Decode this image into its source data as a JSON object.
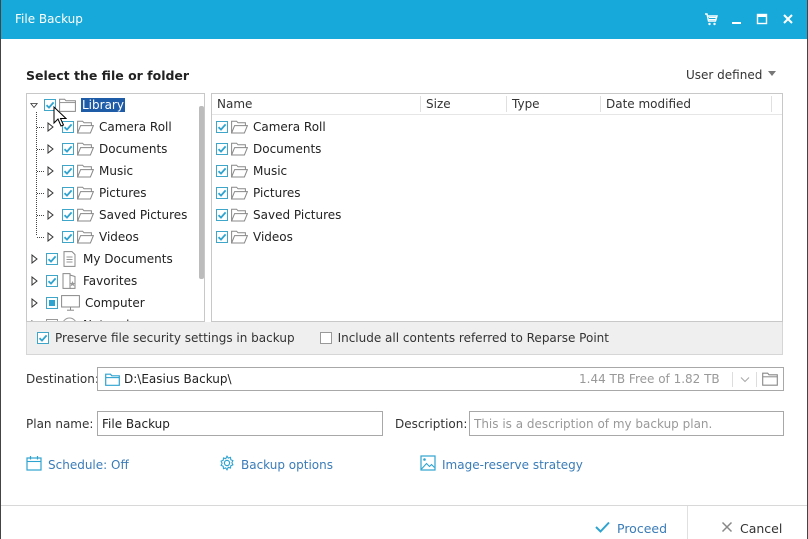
{
  "window": {
    "title": "File Backup",
    "controls": [
      {
        "name": "cart-icon",
        "glyph": "cart"
      },
      {
        "name": "minimize-icon",
        "glyph": "minimize"
      },
      {
        "name": "maximize-icon",
        "glyph": "maximize"
      },
      {
        "name": "close-icon",
        "glyph": "close"
      }
    ]
  },
  "colors": {
    "titlebar": "#17a9da",
    "accent": "#2fa3d0",
    "link": "#3a7cb8",
    "selection": "#1e5ca8"
  },
  "selector": {
    "title": "Select the file or folder",
    "mode": "User defined"
  },
  "tree": {
    "items": [
      {
        "label": "Library",
        "level": 0,
        "expanded": true,
        "checked": "checked",
        "icon": "folder-icon",
        "selected": true
      },
      {
        "label": "Camera Roll",
        "level": 1,
        "expanded": false,
        "checked": "checked",
        "icon": "folder-open-icon"
      },
      {
        "label": "Documents",
        "level": 1,
        "expanded": false,
        "checked": "checked",
        "icon": "folder-open-icon"
      },
      {
        "label": "Music",
        "level": 1,
        "expanded": false,
        "checked": "checked",
        "icon": "folder-open-icon"
      },
      {
        "label": "Pictures",
        "level": 1,
        "expanded": false,
        "checked": "checked",
        "icon": "folder-open-icon"
      },
      {
        "label": "Saved Pictures",
        "level": 1,
        "expanded": false,
        "checked": "checked",
        "icon": "folder-open-icon"
      },
      {
        "label": "Videos",
        "level": 1,
        "expanded": false,
        "checked": "checked",
        "icon": "folder-open-icon"
      },
      {
        "label": "My Documents",
        "level": 0,
        "expanded": false,
        "checked": "checked",
        "icon": "document-icon"
      },
      {
        "label": "Favorites",
        "level": 0,
        "expanded": false,
        "checked": "checked",
        "icon": "favorites-icon"
      },
      {
        "label": "Computer",
        "level": 0,
        "expanded": false,
        "checked": "partial",
        "icon": "computer-icon"
      },
      {
        "label": "Network",
        "level": 0,
        "expanded": false,
        "checked": "unchecked",
        "icon": "network-icon"
      }
    ]
  },
  "file_list": {
    "columns": [
      "Name",
      "Size",
      "Type",
      "Date modified"
    ],
    "rows": [
      {
        "name": "Camera Roll",
        "checked": true
      },
      {
        "name": "Documents",
        "checked": true
      },
      {
        "name": "Music",
        "checked": true
      },
      {
        "name": "Pictures",
        "checked": true
      },
      {
        "name": "Saved Pictures",
        "checked": true
      },
      {
        "name": "Videos",
        "checked": true
      }
    ]
  },
  "options": {
    "preserve_security": {
      "label": "Preserve file security settings in backup",
      "checked": true
    },
    "reparse_point": {
      "label": "Include all contents referred to Reparse Point",
      "checked": false
    }
  },
  "destination": {
    "label": "Destination:",
    "path": "D:\\Easius Backup\\",
    "free_space": "1.44 TB Free of 1.82 TB"
  },
  "plan": {
    "name_label": "Plan name:",
    "name_value": "File Backup",
    "description_label": "Description:",
    "description_placeholder": "This is a description of my backup plan."
  },
  "links": {
    "schedule": "Schedule: Off",
    "backup_options": "Backup options",
    "image_reserve": "Image-reserve strategy"
  },
  "footer": {
    "proceed": "Proceed",
    "cancel": "Cancel"
  }
}
